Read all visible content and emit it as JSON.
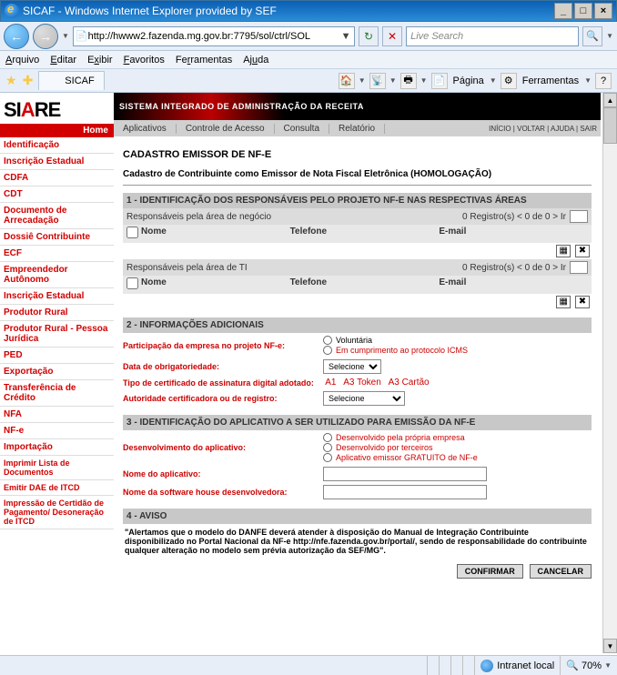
{
  "window": {
    "title": "SICAF - Windows Internet Explorer provided by SEF",
    "min": "_",
    "max": "□",
    "close": "×"
  },
  "nav": {
    "url": "http://hwww2.fazenda.mg.gov.br:7795/sol/ctrl/SOL",
    "refresh": "↻",
    "stop": "✕",
    "search_placeholder": "Live Search",
    "search_icon": "🔍"
  },
  "menu": {
    "arquivo": "Arquivo",
    "editar": "Editar",
    "exibir": "Exibir",
    "favoritos": "Favoritos",
    "ferramentas": "Ferramentas",
    "ajuda": "Ajuda"
  },
  "tabbar": {
    "tab_title": "SICAF",
    "pagina": "Página",
    "ferramentas": "Ferramentas"
  },
  "logo": {
    "si": "SI",
    "a": "A",
    "re": "RE",
    "home": "Home"
  },
  "banner": "SISTEMA INTEGRADO DE ADMINISTRAÇÃO DA RECEITA",
  "subnav": {
    "aplicativos": "Aplicativos",
    "controle": "Controle de Acesso",
    "consulta": "Consulta",
    "relatorio": "Relatório",
    "tiny": "INÍCIO | VOLTAR | AJUDA | SAIR"
  },
  "sidebar": {
    "items": [
      "Identificação",
      "Inscrição Estadual",
      "CDFA",
      "CDT",
      "Documento de Arrecadação",
      "Dossiê Contribuinte",
      "ECF",
      "Empreendedor Autônomo",
      "Inscrição Estadual",
      "Produtor Rural",
      "Produtor Rural - Pessoa Jurídica",
      "PED",
      "Exportação",
      "Transferência de Crédito",
      "NFA",
      "NF-e",
      "Importação",
      "Imprimir Lista de Documentos",
      "Emitir DAE de ITCD",
      "Impressão de Certidão de Pagamento/ Desoneração de ITCD"
    ]
  },
  "form": {
    "heading": "CADASTRO EMISSOR DE NF-E",
    "subheading": "Cadastro de Contribuinte como Emissor de Nota Fiscal Eletrônica (HOMOLOGAÇÃO)",
    "sec1": "1 - IDENTIFICAÇÃO DOS RESPONSÁVEIS PELO PROJETO NF-E NAS RESPECTIVAS ÁREAS",
    "resp_neg": "Responsáveis pela área de negócio",
    "resp_ti": "Responsáveis pela área de TI",
    "reg_text": "0  Registro(s) < 0 de 0 >   Ir",
    "col_nome": "Nome",
    "col_tel": "Telefone",
    "col_email": "E-mail",
    "sec2": "2 - INFORMAÇÕES ADICIONAIS",
    "part_label": "Participação da empresa no projeto NF-e:",
    "part_opt1": "Voluntária",
    "part_opt2": "Em cumprimento ao protocolo ICMS",
    "data_label": "Data de obrigatoriedade:",
    "data_sel": "Selecione",
    "cert_label": "Tipo de certificado de assinatura digital adotado:",
    "cert_opt1": "A1",
    "cert_opt2": "A3 Token",
    "cert_opt3": "A3 Cartão",
    "auth_label": "Autoridade certificadora ou de registro:",
    "auth_sel": "Selecione",
    "sec3": "3 - IDENTIFICAÇÃO DO APLICATIVO A SER UTILIZADO PARA EMISSÃO DA NF-E",
    "dev_label": "Desenvolvimento do aplicativo:",
    "dev_opt1": "Desenvolvido pela própria empresa",
    "dev_opt2": "Desenvolvido por terceiros",
    "dev_opt3": "Aplicativo emissor GRATUITO de NF-e",
    "app_name_label": "Nome do aplicativo:",
    "sw_house_label": "Nome da software house desenvolvedora:",
    "sec4": "4 - AVISO",
    "aviso_text": "\"Alertamos que o modelo do DANFE deverá atender à disposição do Manual de Integração Contribuinte disponibilizado no Portal Nacional da NF-e http://nfe.fazenda.gov.br/portal/, sendo de responsabilidade do contribuinte qualquer alteração no modelo sem prévia autorização da SEF/MG\".",
    "btn_confirm": "CONFIRMAR",
    "btn_cancel": "CANCELAR"
  },
  "status": {
    "zone": "Intranet local",
    "zoom": "70%"
  }
}
